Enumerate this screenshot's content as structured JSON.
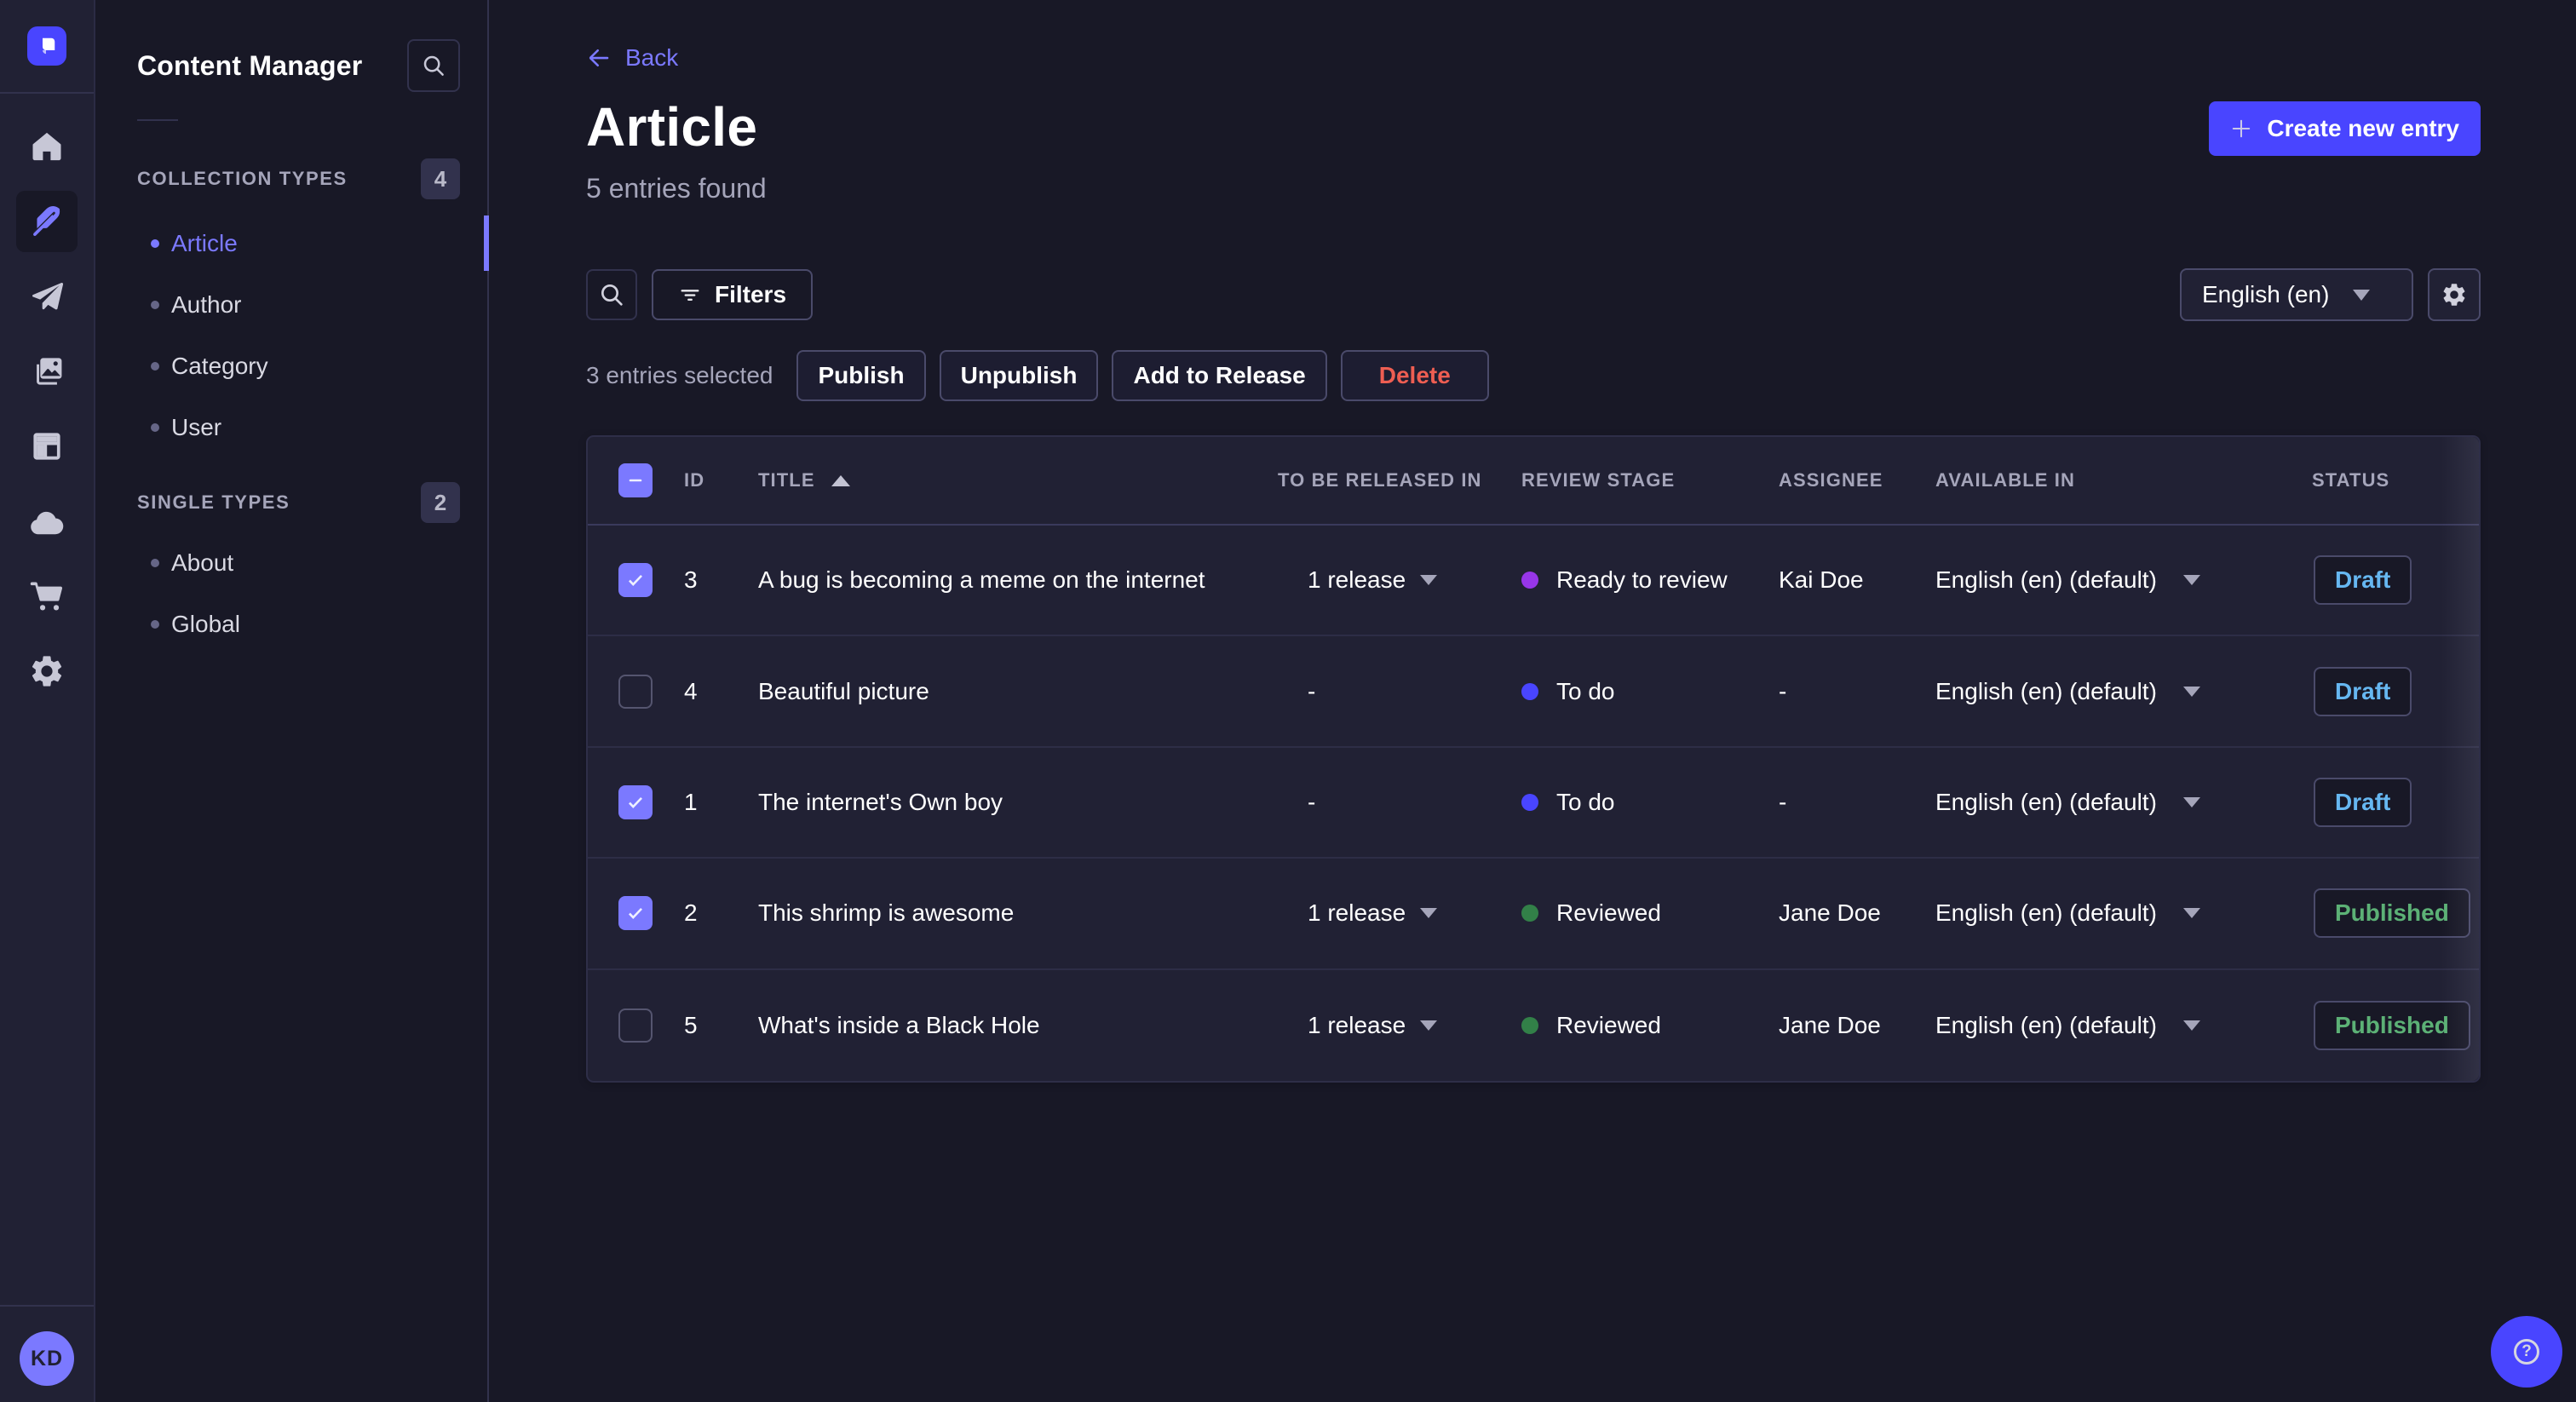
{
  "colors": {
    "accent": "#4945ff",
    "primary_light": "#7b79ff",
    "page_background": "#181826",
    "surface": "#212134",
    "danger": "#ee5e52",
    "draft": "#66b7f1",
    "published": "#5cb176",
    "stage_todo": "#4945ff",
    "stage_ready_to_review": "#9736e8",
    "stage_reviewed": "#328048"
  },
  "rail": {
    "logo_icon": "strapi-logo",
    "icons": [
      "home-icon",
      "feather-icon",
      "send-icon",
      "images-icon",
      "layout-icon",
      "cloud-icon",
      "cart-icon",
      "gear-icon"
    ],
    "active_icon": "feather-icon",
    "avatar_initials": "KD"
  },
  "subnav": {
    "title": "Content Manager",
    "search_icon": "search-icon",
    "sections": [
      {
        "label": "COLLECTION TYPES",
        "count": "4",
        "items": [
          {
            "label": "Article",
            "active": true
          },
          {
            "label": "Author"
          },
          {
            "label": "Category"
          },
          {
            "label": "User"
          }
        ]
      },
      {
        "label": "SINGLE TYPES",
        "count": "2",
        "items": [
          {
            "label": "About"
          },
          {
            "label": "Global"
          }
        ]
      }
    ]
  },
  "header": {
    "back_label": "Back",
    "title": "Article",
    "subtitle": "5 entries found",
    "create_label": "Create new entry"
  },
  "toolbar": {
    "search_icon": "search-icon",
    "filters_label": "Filters",
    "locale_value": "English (en)",
    "settings_icon": "gear-icon"
  },
  "selection": {
    "text": "3 entries selected",
    "publish_label": "Publish",
    "unpublish_label": "Unpublish",
    "add_to_release_label": "Add to Release",
    "delete_label": "Delete"
  },
  "table": {
    "columns": {
      "id": "ID",
      "title": "TITLE",
      "release": "TO BE RELEASED IN",
      "stage": "REVIEW STAGE",
      "assignee": "ASSIGNEE",
      "available": "AVAILABLE IN",
      "status": "STATUS"
    },
    "title_sorted_asc": true,
    "rows": [
      {
        "checked": true,
        "id": "3",
        "title": "A bug is becoming a meme on the internet",
        "release": "1 release",
        "release_caret": true,
        "stage": {
          "label": "Ready to review",
          "color": "#9736e8"
        },
        "assignee": "Kai Doe",
        "available": "English (en) (default)",
        "status": {
          "label": "Draft",
          "color": "#66b7f1"
        }
      },
      {
        "checked": false,
        "id": "4",
        "title": "Beautiful picture",
        "release": "-",
        "release_caret": false,
        "stage": {
          "label": "To do",
          "color": "#4945ff"
        },
        "assignee": "-",
        "available": "English (en) (default)",
        "status": {
          "label": "Draft",
          "color": "#66b7f1"
        }
      },
      {
        "checked": true,
        "id": "1",
        "title": "The internet's Own boy",
        "release": "-",
        "release_caret": false,
        "stage": {
          "label": "To do",
          "color": "#4945ff"
        },
        "assignee": "-",
        "available": "English (en) (default)",
        "status": {
          "label": "Draft",
          "color": "#66b7f1"
        }
      },
      {
        "checked": true,
        "id": "2",
        "title": "This shrimp is awesome",
        "release": "1 release",
        "release_caret": true,
        "stage": {
          "label": "Reviewed",
          "color": "#328048"
        },
        "assignee": "Jane Doe",
        "available": "English (en) (default)",
        "status": {
          "label": "Published",
          "color": "#5cb176"
        }
      },
      {
        "checked": false,
        "id": "5",
        "title": "What's inside a Black Hole",
        "release": "1 release",
        "release_caret": true,
        "stage": {
          "label": "Reviewed",
          "color": "#328048"
        },
        "assignee": "Jane Doe",
        "available": "English (en) (default)",
        "status": {
          "label": "Published",
          "color": "#5cb176"
        }
      }
    ]
  },
  "help": {
    "icon": "question-icon"
  }
}
